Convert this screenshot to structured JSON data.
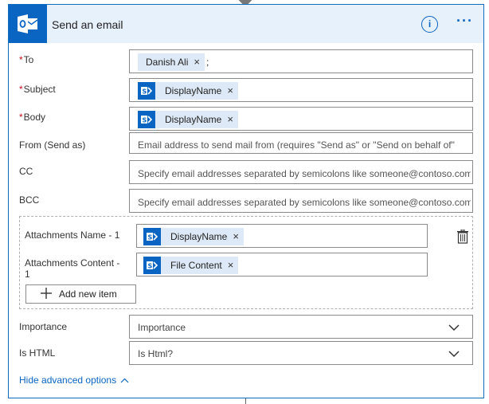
{
  "header": {
    "title": "Send an email",
    "info_glyph": "i",
    "more_glyph": "···"
  },
  "colors": {
    "accent": "#0a64c2",
    "header_bg": "#e7f1fb",
    "token_bg": "#dde9f6",
    "required": "#c50f1f"
  },
  "fields": {
    "to": {
      "label": "To",
      "required_mark": "*",
      "token": "Danish Ali",
      "separator": ";"
    },
    "subject": {
      "label": "Subject",
      "required_mark": "*",
      "token": "DisplayName"
    },
    "body": {
      "label": "Body",
      "required_mark": "*",
      "token": "DisplayName"
    },
    "from": {
      "label": "From (Send as)",
      "placeholder": "Email address to send mail from (requires \"Send as\" or \"Send on behalf of\""
    },
    "cc": {
      "label": "CC",
      "placeholder": "Specify email addresses separated by semicolons like someone@contoso.com"
    },
    "bcc": {
      "label": "BCC",
      "placeholder": "Specify email addresses separated by semicolons like someone@contoso.com"
    }
  },
  "attachments": {
    "name_label": "Attachments Name - 1",
    "name_token": "DisplayName",
    "content_label_1": "Attachments Content -",
    "content_label_2": "1",
    "content_token": "File Content",
    "add_item_label": "Add new item"
  },
  "importance": {
    "label": "Importance",
    "value": "Importance"
  },
  "is_html": {
    "label": "Is HTML",
    "value": "Is Html?"
  },
  "advanced": {
    "label": "Hide advanced options"
  },
  "token_remove_glyph": "×",
  "icons": {
    "app": "outlook-icon",
    "token": "sharepoint-icon",
    "trash": "trash-icon",
    "chevron": "chevron-down-icon"
  }
}
